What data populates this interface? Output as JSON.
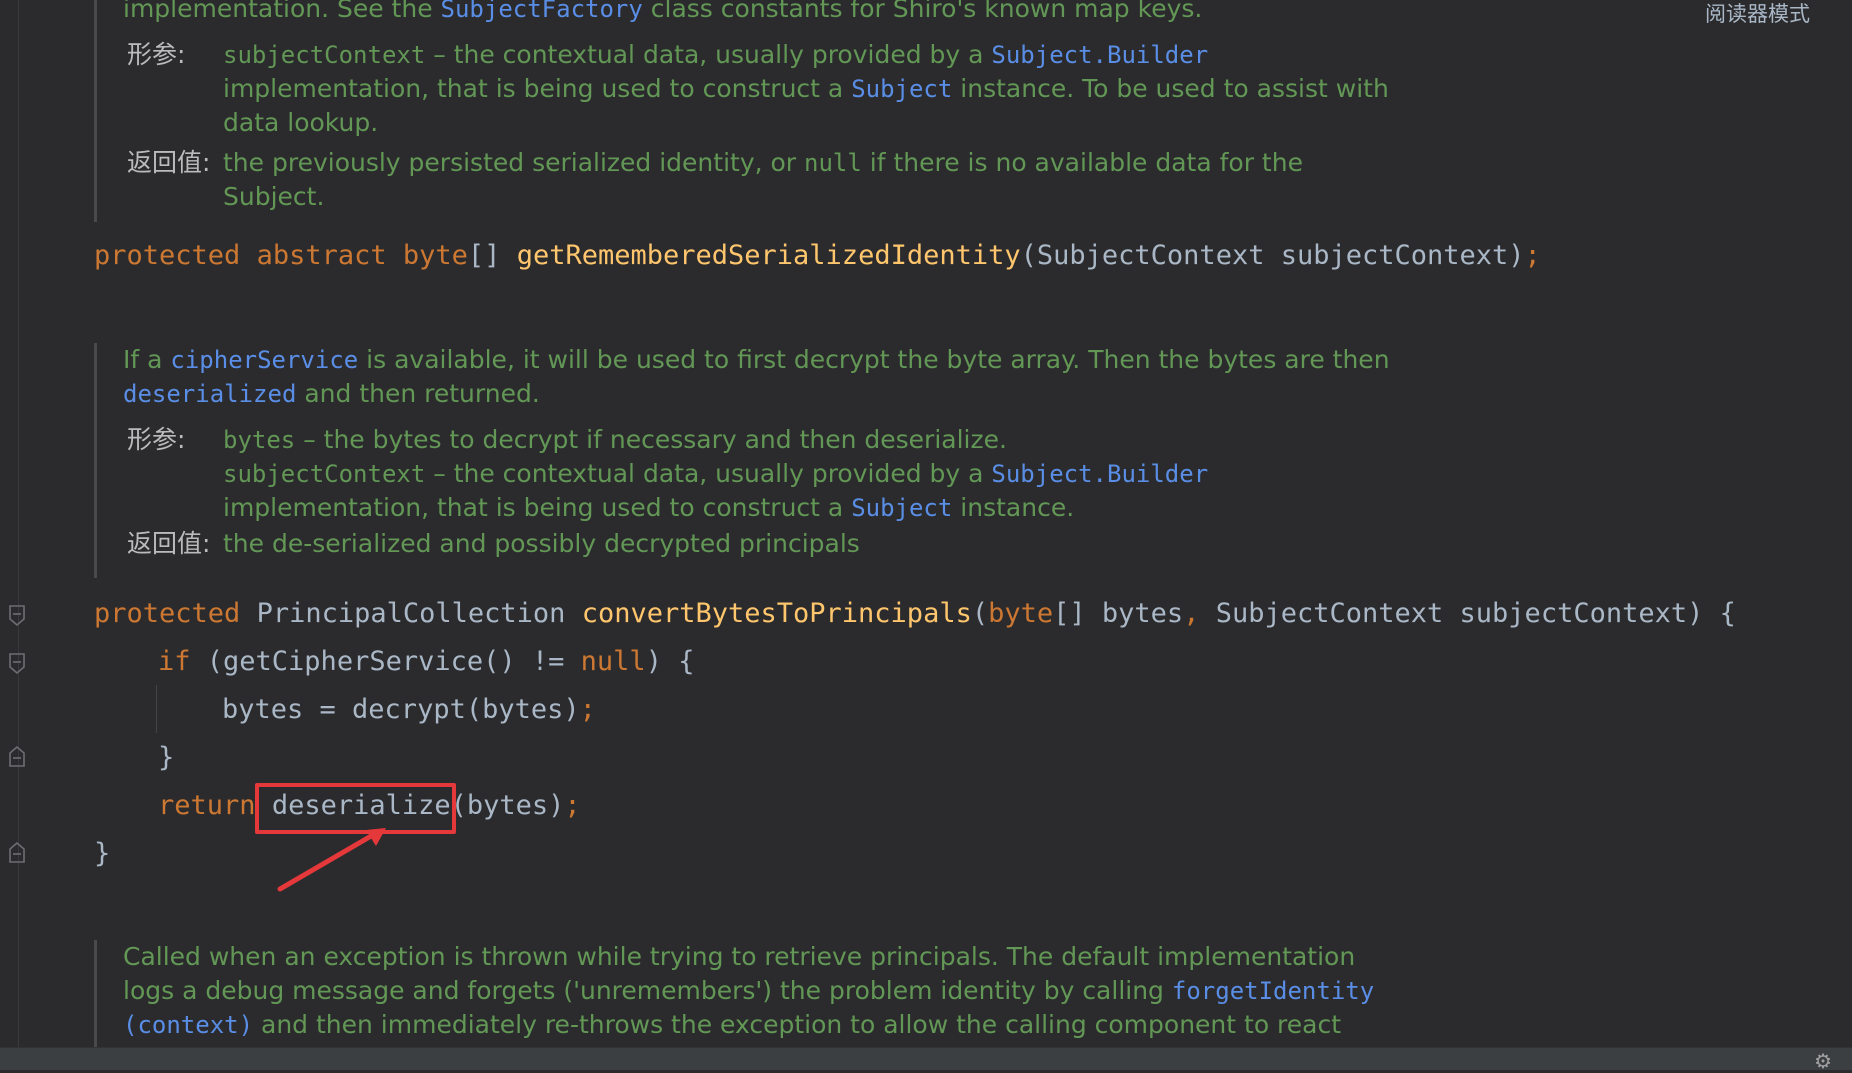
{
  "reader_mode": "阅读器模式",
  "doc1": {
    "line0_pre": "implementation. See the ",
    "line0_link": "SubjectFactory",
    "line0_post": " class constants for Shiro's known map keys.",
    "param_tag": "形参:",
    "param_name": "subjectContext",
    "param_text1": " – the contextual data, usually provided by a ",
    "param_link1": "Subject.Builder",
    "param_text2": "implementation, that is being used to construct a ",
    "param_link2": "Subject",
    "param_text3": " instance. To be used to assist with",
    "param_text4": "data lookup.",
    "return_tag": "返回值:",
    "return_text1": "the previously persisted serialized identity, or ",
    "return_null": "null",
    "return_text2": " if there is no available data for the",
    "return_text3": "Subject."
  },
  "sig1": {
    "kw1": "protected",
    "kw2": "abstract",
    "type": "byte",
    "brackets": "[]",
    "name": "getRememberedSerializedIdentity",
    "params": "(SubjectContext subjectContext)",
    "semi": ";"
  },
  "doc2": {
    "t1": "If a ",
    "link1": "cipherService",
    "t2": " is available, it will be used to first decrypt the byte array. Then the bytes are then",
    "link2": "deserialized",
    "t3": " and then returned.",
    "param_tag": "形参:",
    "p1_name": "bytes",
    "p1_text": " – the bytes to decrypt if necessary and then deserialize.",
    "p2_name": "subjectContext",
    "p2_text1": " – the contextual data, usually provided by a ",
    "p2_link1": "Subject.Builder",
    "p2_text2": "implementation, that is being used to construct a ",
    "p2_link2": "Subject",
    "p2_text3": " instance.",
    "return_tag": "返回值:",
    "return_text": "the de-serialized and possibly decrypted principals"
  },
  "code": {
    "l1_kw": "protected",
    "l1_type": "PrincipalCollection",
    "l1_name": "convertBytesToPrincipals",
    "l1_open": "(",
    "l1_ptype": "byte",
    "l1_rest1": "[] bytes",
    "l1_comma": ",",
    "l1_rest2": " SubjectContext subjectContext) {",
    "l2_kw": "if",
    "l2_mid": " (getCipherService() != ",
    "l2_null": "null",
    "l2_end": ") {",
    "l3": "bytes = decrypt(bytes)",
    "l3_semi": ";",
    "l4": "}",
    "l5_kw": "return",
    "l5_call": "deserialize",
    "l5_rest": "(bytes)",
    "l5_semi": ";",
    "l6": "}"
  },
  "doc3": {
    "t1": "Called when an exception is thrown while trying to retrieve principals. The default implementation",
    "t2": "logs a debug message and forgets ('unremembers') the problem identity by calling ",
    "link1": "forgetIdentity",
    "link2": "(context)",
    "t3": " and then immediately re-throws the exception to allow the calling component to react"
  },
  "colors": {
    "background": "#2b2b2d",
    "keyword": "#cc7832",
    "function": "#ffc66d",
    "doc_text": "#629755",
    "doc_link": "#5a8ee6",
    "annotation": "#e5383b"
  }
}
